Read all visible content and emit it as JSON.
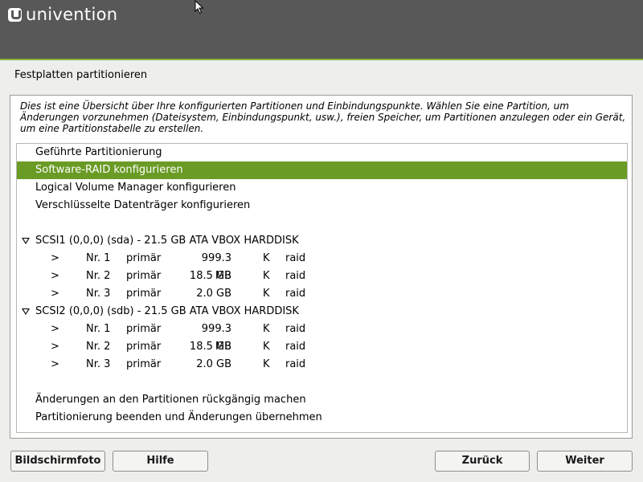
{
  "brand": {
    "name": "univention"
  },
  "page": {
    "title": "Festplatten partitionieren"
  },
  "description": "Dies ist eine Übersicht über Ihre konfigurierten Partitionen und Einbindungspunkte. Wählen Sie eine Partition, um Änderungen vorzunehmen (Dateisystem, Einbindungspunkt, usw.), freien Speicher, um Partitionen anzulegen oder ein Gerät, um eine Partitionstabelle zu erstellen.",
  "list": {
    "actions": [
      "Geführte Partitionierung",
      "Software-RAID konfigurieren",
      "Logical Volume Manager konfigurieren",
      "Verschlüsselte Datenträger konfigurieren"
    ],
    "selected_index": 1,
    "disks": [
      {
        "label": "SCSI1 (0,0,0) (sda) - 21.5 GB ATA VBOX HARDDISK",
        "partitions": [
          {
            "arrow": ">",
            "nr": "Nr. 1",
            "type": "primär",
            "size": "999.3 MB",
            "flag": "K",
            "fs": "raid"
          },
          {
            "arrow": ">",
            "nr": "Nr. 2",
            "type": "primär",
            "size": "18.5 GB",
            "flag": "K",
            "fs": "raid"
          },
          {
            "arrow": ">",
            "nr": "Nr. 3",
            "type": "primär",
            "size": "2.0 GB",
            "flag": "K",
            "fs": "raid"
          }
        ]
      },
      {
        "label": "SCSI2 (0,0,0) (sdb) - 21.5 GB ATA VBOX HARDDISK",
        "partitions": [
          {
            "arrow": ">",
            "nr": "Nr. 1",
            "type": "primär",
            "size": "999.3 MB",
            "flag": "K",
            "fs": "raid"
          },
          {
            "arrow": ">",
            "nr": "Nr. 2",
            "type": "primär",
            "size": "18.5 GB",
            "flag": "K",
            "fs": "raid"
          },
          {
            "arrow": ">",
            "nr": "Nr. 3",
            "type": "primär",
            "size": "2.0 GB",
            "flag": "K",
            "fs": "raid"
          }
        ]
      }
    ],
    "footer_actions": [
      "Änderungen an den Partitionen rückgängig machen",
      "Partitionierung beenden und Änderungen übernehmen"
    ]
  },
  "buttons": {
    "screenshot": "Bildschirmfoto",
    "help": "Hilfe",
    "back": "Zurück",
    "next": "Weiter"
  },
  "colors": {
    "header": "#585858",
    "accent": "#86b043",
    "selection": "#6a9b25"
  },
  "icons": {
    "logo": "univention-logo-icon",
    "cursor": "mouse-pointer-icon",
    "expander": "triangle-down-icon"
  }
}
